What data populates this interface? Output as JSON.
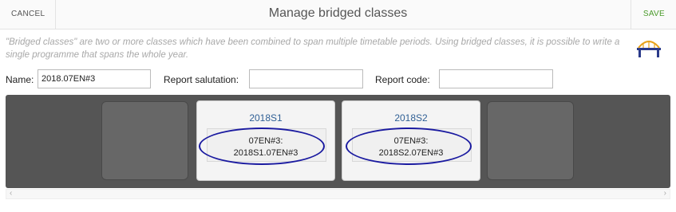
{
  "header": {
    "cancel_label": "CANCEL",
    "title": "Manage bridged classes",
    "save_label": "SAVE"
  },
  "description": "\"Bridged classes\" are two or more classes which have been combined to span multiple timetable periods. Using bridged classes, it is possible to write a single programme that spans the whole year.",
  "form": {
    "name_label": "Name:",
    "name_value": "2018.07EN#3",
    "salutation_label": "Report salutation:",
    "salutation_value": "",
    "code_label": "Report code:",
    "code_value": ""
  },
  "classes": [
    {
      "period": "2018S1",
      "class_line1": "07EN#3:",
      "class_line2": "2018S1.07EN#3"
    },
    {
      "period": "2018S2",
      "class_line1": "07EN#3:",
      "class_line2": "2018S2.07EN#3"
    }
  ],
  "colors": {
    "save": "#4a9a2a",
    "period_title": "#2f5f95",
    "highlight_oval": "#1a1aa0",
    "strip_bg": "#555555"
  },
  "icons": {
    "bridge": "bridge-icon",
    "scroll_left": "chevron-left-icon",
    "scroll_right": "chevron-right-icon"
  }
}
